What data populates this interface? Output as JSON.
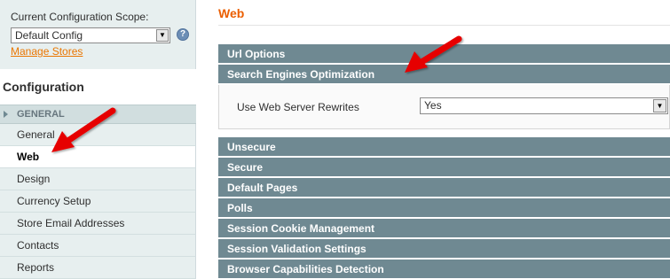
{
  "scope": {
    "label": "Current Configuration Scope:",
    "selected": "Default Config",
    "manage_link": "Manage Stores",
    "help_glyph": "?"
  },
  "sidebar": {
    "title": "Configuration",
    "group_label": "GENERAL",
    "items": [
      {
        "label": "General"
      },
      {
        "label": "Web"
      },
      {
        "label": "Design"
      },
      {
        "label": "Currency Setup"
      },
      {
        "label": "Store Email Addresses"
      },
      {
        "label": "Contacts"
      },
      {
        "label": "Reports"
      }
    ]
  },
  "main": {
    "title": "Web",
    "sections": [
      {
        "label": "Url Options"
      },
      {
        "label": "Search Engines Optimization"
      },
      {
        "label": "Unsecure"
      },
      {
        "label": "Secure"
      },
      {
        "label": "Default Pages"
      },
      {
        "label": "Polls"
      },
      {
        "label": "Session Cookie Management"
      },
      {
        "label": "Session Validation Settings"
      },
      {
        "label": "Browser Capabilities Detection"
      }
    ],
    "seo_field": {
      "label": "Use Web Server Rewrites",
      "value": "Yes"
    }
  },
  "colors": {
    "accent_orange": "#eb5e00",
    "section_bar": "#6f8992",
    "annotation_red": "#e60000"
  }
}
